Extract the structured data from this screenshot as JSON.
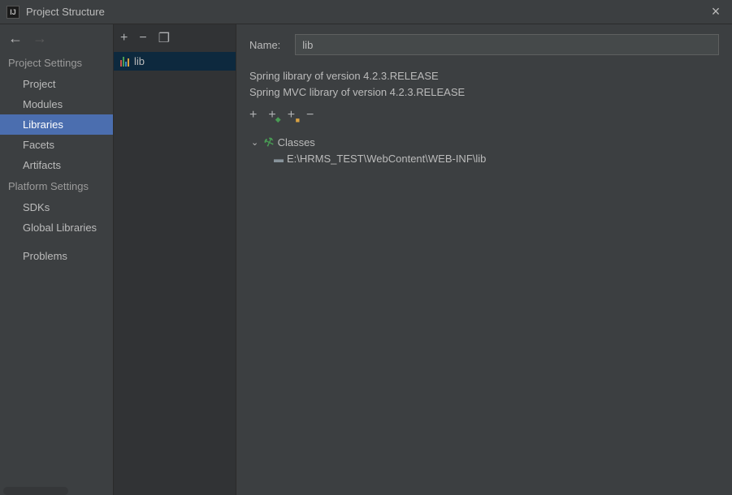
{
  "window": {
    "title": "Project Structure"
  },
  "sidebar": {
    "section1_label": "Project Settings",
    "section2_label": "Platform Settings",
    "items": [
      {
        "label": "Project"
      },
      {
        "label": "Modules"
      },
      {
        "label": "Libraries"
      },
      {
        "label": "Facets"
      },
      {
        "label": "Artifacts"
      }
    ],
    "platform_items": [
      {
        "label": "SDKs"
      },
      {
        "label": "Global Libraries"
      }
    ],
    "problems_label": "Problems"
  },
  "libraries": {
    "items": [
      {
        "label": "lib"
      }
    ]
  },
  "details": {
    "name_label": "Name:",
    "name_value": "lib",
    "desc1": "Spring library of version 4.2.3.RELEASE",
    "desc2": "Spring MVC library of version 4.2.3.RELEASE",
    "classes_label": "Classes",
    "classes_path": "E:\\HRMS_TEST\\WebContent\\WEB-INF\\lib"
  }
}
